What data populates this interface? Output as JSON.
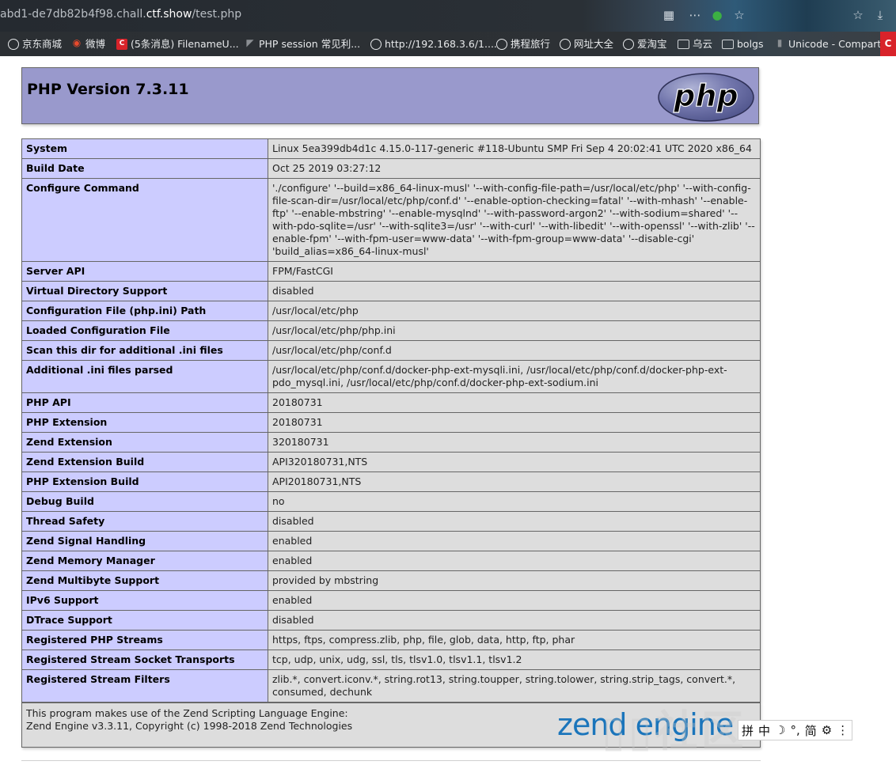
{
  "browser": {
    "url_prefix": "abd1-de7db82b4f98.chall.",
    "url_domain": "ctf.show",
    "url_path": "/test.php",
    "bookmarks": [
      {
        "label": "京东商城",
        "icon": "globe-icon"
      },
      {
        "label": "微博",
        "icon": "weibo-icon"
      },
      {
        "label": "(5条消息) FilenameU...",
        "icon": "csdn-icon"
      },
      {
        "label": "PHP session 常见利...",
        "icon": "bookmark-icon"
      },
      {
        "label": "http://192.168.3.6/1....",
        "icon": "globe-icon"
      },
      {
        "label": "携程旅行",
        "icon": "globe-icon"
      },
      {
        "label": "网址大全",
        "icon": "globe-icon"
      },
      {
        "label": "爱淘宝",
        "icon": "globe-icon"
      },
      {
        "label": "乌云",
        "icon": "folder-icon"
      },
      {
        "label": "bolgs",
        "icon": "folder-icon"
      },
      {
        "label": "Unicode - Compart",
        "icon": "bookmark-icon"
      }
    ]
  },
  "phpinfo": {
    "title": "PHP Version 7.3.11",
    "logo_text": "php",
    "rows": [
      {
        "key": "System",
        "value": "Linux 5ea399db4d1c 4.15.0-117-generic #118-Ubuntu SMP Fri Sep 4 20:02:41 UTC 2020 x86_64"
      },
      {
        "key": "Build Date",
        "value": "Oct 25 2019 03:27:12"
      },
      {
        "key": "Configure Command",
        "value": "'./configure' '--build=x86_64-linux-musl' '--with-config-file-path=/usr/local/etc/php' '--with-config-file-scan-dir=/usr/local/etc/php/conf.d' '--enable-option-checking=fatal' '--with-mhash' '--enable-ftp' '--enable-mbstring' '--enable-mysqlnd' '--with-password-argon2' '--with-sodium=shared' '--with-pdo-sqlite=/usr' '--with-sqlite3=/usr' '--with-curl' '--with-libedit' '--with-openssl' '--with-zlib' '--enable-fpm' '--with-fpm-user=www-data' '--with-fpm-group=www-data' '--disable-cgi' 'build_alias=x86_64-linux-musl'"
      },
      {
        "key": "Server API",
        "value": "FPM/FastCGI"
      },
      {
        "key": "Virtual Directory Support",
        "value": "disabled"
      },
      {
        "key": "Configuration File (php.ini) Path",
        "value": "/usr/local/etc/php"
      },
      {
        "key": "Loaded Configuration File",
        "value": "/usr/local/etc/php/php.ini"
      },
      {
        "key": "Scan this dir for additional .ini files",
        "value": "/usr/local/etc/php/conf.d"
      },
      {
        "key": "Additional .ini files parsed",
        "value": "/usr/local/etc/php/conf.d/docker-php-ext-mysqli.ini, /usr/local/etc/php/conf.d/docker-php-ext-pdo_mysql.ini, /usr/local/etc/php/conf.d/docker-php-ext-sodium.ini"
      },
      {
        "key": "PHP API",
        "value": "20180731"
      },
      {
        "key": "PHP Extension",
        "value": "20180731"
      },
      {
        "key": "Zend Extension",
        "value": "320180731"
      },
      {
        "key": "Zend Extension Build",
        "value": "API320180731,NTS"
      },
      {
        "key": "PHP Extension Build",
        "value": "API20180731,NTS"
      },
      {
        "key": "Debug Build",
        "value": "no"
      },
      {
        "key": "Thread Safety",
        "value": "disabled"
      },
      {
        "key": "Zend Signal Handling",
        "value": "enabled"
      },
      {
        "key": "Zend Memory Manager",
        "value": "enabled"
      },
      {
        "key": "Zend Multibyte Support",
        "value": "provided by mbstring"
      },
      {
        "key": "IPv6 Support",
        "value": "enabled"
      },
      {
        "key": "DTrace Support",
        "value": "disabled"
      },
      {
        "key": "Registered PHP Streams",
        "value": "https, ftps, compress.zlib, php, file, glob, data, http, ftp, phar"
      },
      {
        "key": "Registered Stream Socket Transports",
        "value": "tcp, udp, unix, udg, ssl, tls, tlsv1.0, tlsv1.1, tlsv1.2"
      },
      {
        "key": "Registered Stream Filters",
        "value": "zlib.*, convert.iconv.*, string.rot13, string.toupper, string.tolower, string.strip_tags, convert.*, consumed, dechunk"
      }
    ],
    "zend_line1": "This program makes use of the Zend Scripting Language Engine:",
    "zend_line2": "Zend Engine v3.3.11, Copyright (c) 1998-2018 Zend Technologies",
    "zend_logo_text": "zend engine"
  },
  "ime": {
    "items": [
      "拼",
      "中",
      "☽",
      "°,",
      "简",
      "⚙",
      "⋮"
    ]
  },
  "colors": {
    "header_bg": "#9999cc",
    "key_bg": "#ccccff",
    "value_bg": "#dddddd",
    "zend_blue": "#1b75bb"
  }
}
